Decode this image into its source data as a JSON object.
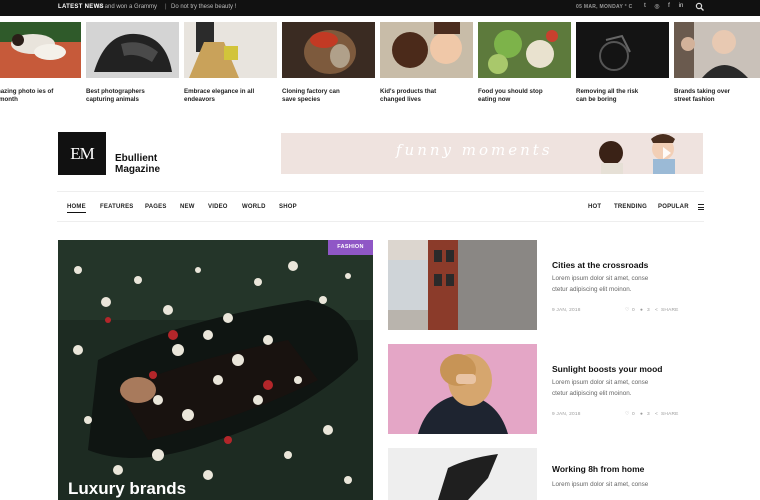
{
  "topbar": {
    "label": "LATEST NEWS",
    "ticker_1": "sit and won a Grammy",
    "separator": "|",
    "ticker_2": "Do not try these beauty !",
    "date": "05 MAR, MONDAY ° C",
    "social": [
      {
        "icon": "twitter-icon",
        "glyph": "t"
      },
      {
        "icon": "instagram-icon",
        "glyph": "◎"
      },
      {
        "icon": "facebook-icon",
        "glyph": "f"
      },
      {
        "icon": "linkedin-icon",
        "glyph": "in"
      }
    ]
  },
  "thumbnails": [
    {
      "caption": "t amazing photo ies of the month",
      "color": "#7b6d58"
    },
    {
      "caption": "Best photographers capturing animals",
      "color": "#3b3b3b"
    },
    {
      "caption": "Embrace elegance in all endeavors",
      "color": "#c7a877"
    },
    {
      "caption": "Cloning factory can save species",
      "color": "#8a3c2a"
    },
    {
      "caption": "Kid's products that changed lives",
      "color": "#b56a4f"
    },
    {
      "caption": "Food you should stop eating now",
      "color": "#7fa05a"
    },
    {
      "caption": "Removing all the risk can be boring",
      "color": "#1d1d1d"
    },
    {
      "caption": "Brands taking over street fashion",
      "color": "#9b8e86"
    }
  ],
  "brand": {
    "logo": "EM",
    "name_line1": "Ebullient",
    "name_line2": "Magazine",
    "banner_text": "funny moments"
  },
  "nav": {
    "left": [
      "HOME",
      "FEATURES",
      "PAGES",
      "NEW",
      "VIDEO",
      "WORLD",
      "SHOP"
    ],
    "right": [
      "HOT",
      "TRENDING",
      "POPULAR"
    ]
  },
  "feature": {
    "tag": "FASHION",
    "title": "Luxury brands",
    "tag_color": "#8f57c6"
  },
  "articles": [
    {
      "title": "Cities at the crossroads",
      "excerpt_1": "Lorem ipsum dolor sit amet, conse",
      "excerpt_2": "ctetur adipiscing elit moinon.",
      "date": "9 JAN, 2018",
      "likes": "0",
      "comments": "3",
      "share": "SHARE"
    },
    {
      "title": "Sunlight boosts your mood",
      "excerpt_1": "Lorem ipsum dolor sit amet, conse",
      "excerpt_2": "ctetur adipiscing elit moinon.",
      "date": "9 JAN, 2018",
      "likes": "0",
      "comments": "3",
      "share": "SHARE"
    },
    {
      "title": "Working 8h from home",
      "excerpt_1": "Lorem ipsum dolor sit amet, conse",
      "excerpt_2": "",
      "date": "",
      "likes": "",
      "comments": "",
      "share": ""
    }
  ]
}
